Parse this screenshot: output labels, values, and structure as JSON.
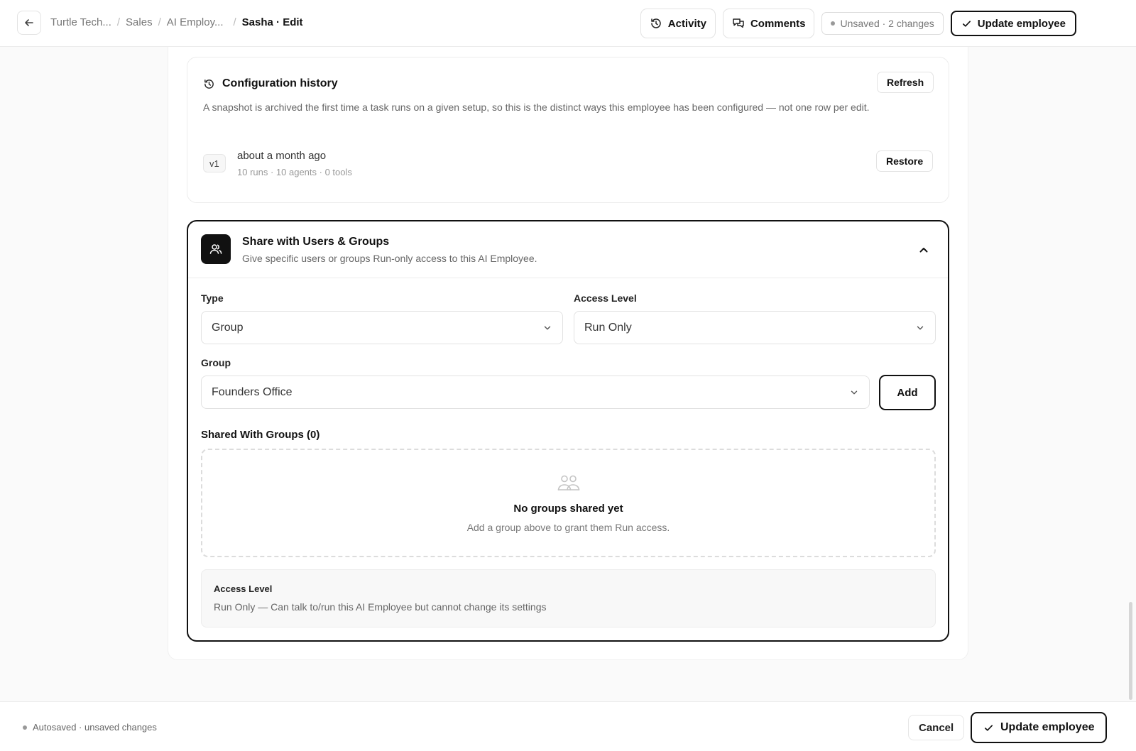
{
  "header": {
    "breadcrumbs": [
      "Turtle Tech...",
      "Sales",
      "AI Employ...",
      "Sasha · Edit"
    ],
    "activity_label": "Activity",
    "comments_label": "Comments",
    "status_label": "Unsaved · 2 changes",
    "update_label": "Update employee"
  },
  "history": {
    "title": "Configuration history",
    "refresh_label": "Refresh",
    "description": "A snapshot is archived the first time a task runs on a given setup, so this is the distinct ways this employee has been configured — not one row per edit.",
    "versions": [
      {
        "badge": "v1",
        "time": "about a month ago",
        "meta": "10 runs · 10 agents · 0 tools",
        "restore_label": "Restore"
      }
    ]
  },
  "share": {
    "title": "Share with Users & Groups",
    "subtitle": "Give specific users or groups Run-only access to this AI Employee.",
    "type_label": "Type",
    "type_value": "Group",
    "access_label": "Access Level",
    "access_value": "Run Only",
    "group_label": "Group",
    "group_value": "Founders Office",
    "add_label": "Add",
    "shared_label": "Shared With Groups (0)",
    "empty_title": "No groups shared yet",
    "empty_sub": "Add a group above to grant them Run access.",
    "info_title": "Access Level",
    "info_text": "Run Only — Can talk to/run this AI Employee but cannot change its settings"
  },
  "footer": {
    "autosave_label": "Autosaved · unsaved changes",
    "cancel_label": "Cancel",
    "update_label": "Update employee"
  }
}
